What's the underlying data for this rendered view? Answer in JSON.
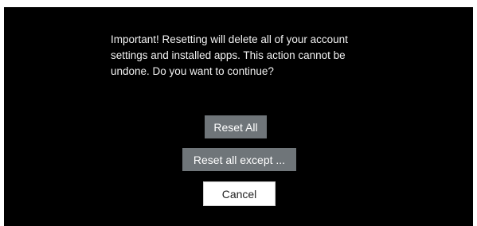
{
  "dialog": {
    "message_lines": [
      "Important! Resetting will delete all of your account",
      "settings and installed apps. This action cannot be",
      "undone. Do you want to continue?"
    ],
    "buttons": {
      "reset_all": "Reset All",
      "reset_all_except": "Reset all except ...",
      "cancel": "Cancel"
    }
  },
  "colors": {
    "background": "#000000",
    "text": "#f2f2f2",
    "button_gray": "#6f7579",
    "button_white": "#ffffff"
  }
}
